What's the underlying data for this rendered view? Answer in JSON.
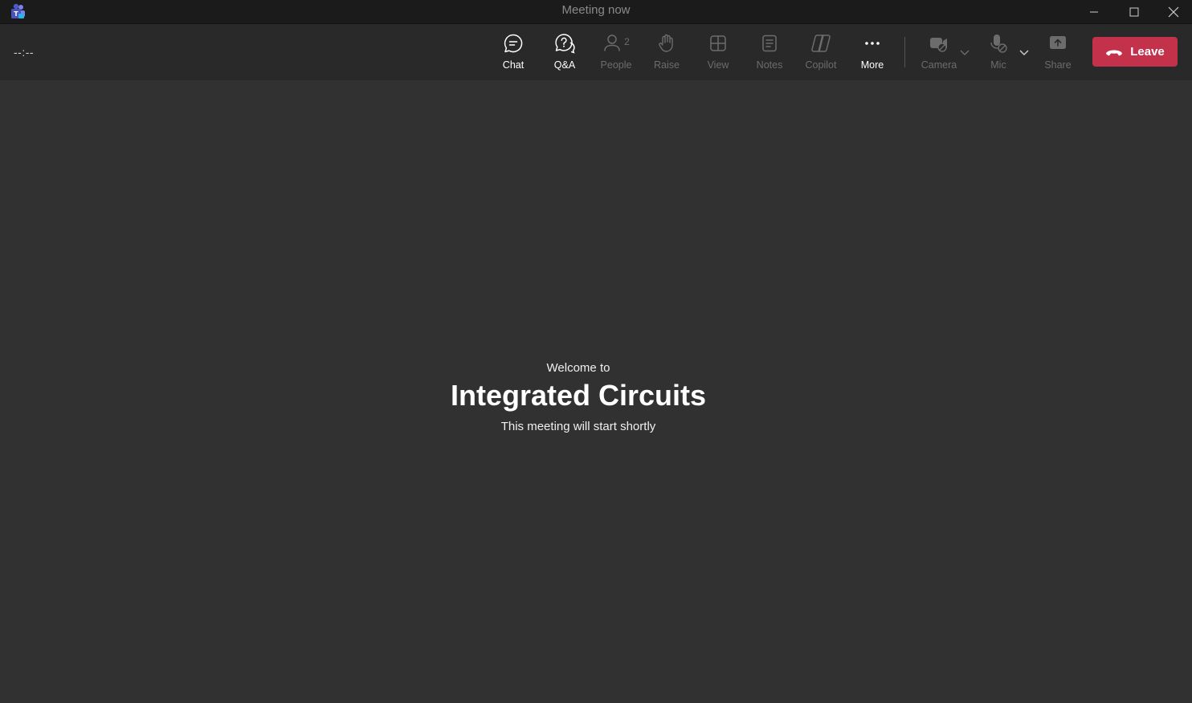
{
  "window": {
    "title": "Meeting now"
  },
  "toolbar": {
    "timer": "--:--",
    "buttons": {
      "chat": "Chat",
      "qa": "Q&A",
      "people": "People",
      "people_count": "2",
      "raise": "Raise",
      "view": "View",
      "notes": "Notes",
      "copilot": "Copilot",
      "more": "More",
      "camera": "Camera",
      "mic": "Mic",
      "share": "Share"
    },
    "leave_label": "Leave"
  },
  "stage": {
    "welcome": "Welcome to",
    "meeting_name": "Integrated Circuits",
    "status": "This meeting will start shortly"
  },
  "colors": {
    "leave": "#c4314b",
    "background": "#313131",
    "toolbar": "#292929",
    "titlebar": "#1b1b1b"
  }
}
